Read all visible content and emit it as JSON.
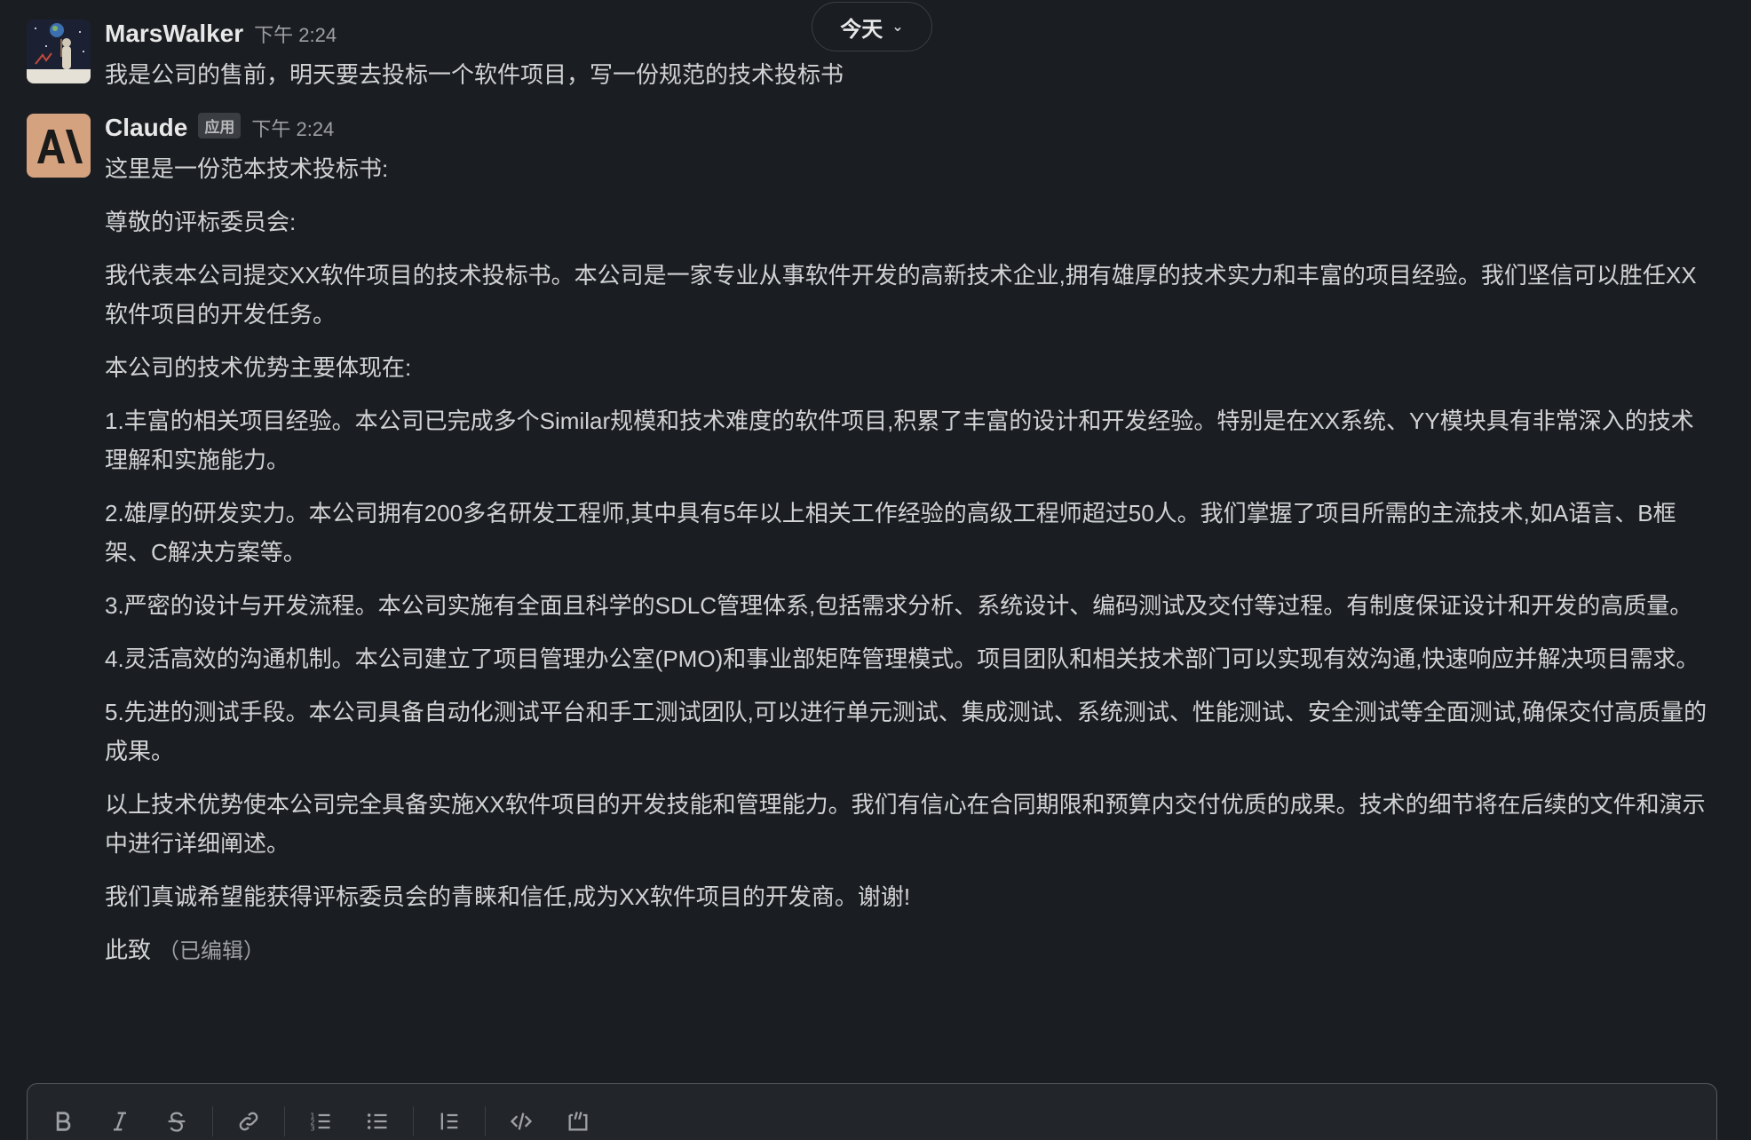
{
  "date_divider": {
    "label": "今天"
  },
  "messages": [
    {
      "sender": "MarsWalker",
      "time": "下午 2:24",
      "text": "我是公司的售前，明天要去投标一个软件项目，写一份规范的技术投标书"
    },
    {
      "sender": "Claude",
      "badge": "应用",
      "time": "下午 2:24",
      "paragraphs": [
        "这里是一份范本技术投标书:",
        "尊敬的评标委员会:",
        "我代表本公司提交XX软件项目的技术投标书。本公司是一家专业从事软件开发的高新技术企业,拥有雄厚的技术实力和丰富的项目经验。我们坚信可以胜任XX软件项目的开发任务。",
        "本公司的技术优势主要体现在:",
        "1.丰富的相关项目经验。本公司已完成多个Similar规模和技术难度的软件项目,积累了丰富的设计和开发经验。特别是在XX系统、YY模块具有非常深入的技术理解和实施能力。",
        "2.雄厚的研发实力。本公司拥有200多名研发工程师,其中具有5年以上相关工作经验的高级工程师超过50人。我们掌握了项目所需的主流技术,如A语言、B框架、C解决方案等。",
        "3.严密的设计与开发流程。本公司实施有全面且科学的SDLC管理体系,包括需求分析、系统设计、编码测试及交付等过程。有制度保证设计和开发的高质量。",
        "4.灵活高效的沟通机制。本公司建立了项目管理办公室(PMO)和事业部矩阵管理模式。项目团队和相关技术部门可以实现有效沟通,快速响应并解决项目需求。",
        "5.先进的测试手段。本公司具备自动化测试平台和手工测试团队,可以进行单元测试、集成测试、系统测试、性能测试、安全测试等全面测试,确保交付高质量的成果。",
        "以上技术优势使本公司完全具备实施XX软件项目的开发技能和管理能力。我们有信心在合同期限和预算内交付优质的成果。技术的细节将在后续的文件和演示中进行详细阐述。",
        "我们真诚希望能获得评标委员会的青睐和信任,成为XX软件项目的开发商。谢谢!",
        "此致"
      ],
      "edited_label": "（已编辑）"
    }
  ],
  "composer_toolbar": [
    {
      "icon": "bold-icon"
    },
    {
      "icon": "italic-icon"
    },
    {
      "icon": "strikethrough-icon"
    },
    {
      "icon": "link-icon"
    },
    {
      "icon": "ordered-list-icon"
    },
    {
      "icon": "bulleted-list-icon"
    },
    {
      "icon": "blockquote-icon"
    },
    {
      "icon": "code-icon"
    },
    {
      "icon": "code-block-icon"
    }
  ],
  "colors": {
    "background": "#1a1d21",
    "text": "#d1d2d3",
    "muted": "#9ea0a3",
    "claude_avatar": "#d4a27f"
  }
}
